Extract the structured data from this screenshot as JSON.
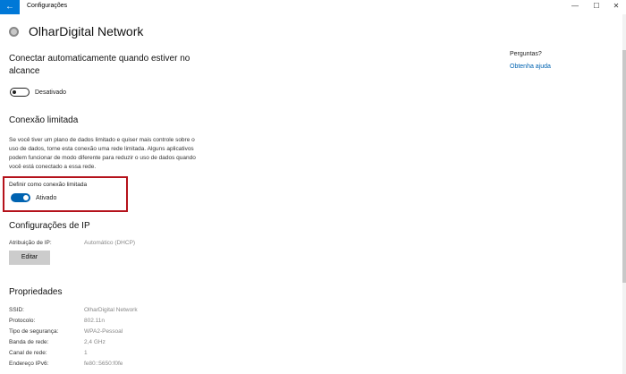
{
  "window": {
    "back_glyph": "←",
    "title": "Configurações",
    "minimize_glyph": "—",
    "maximize_glyph": "☐",
    "close_glyph": "✕"
  },
  "header": {
    "icon": "gear-icon",
    "title": "OlharDigital Network"
  },
  "autoconnect": {
    "title": "Conectar automaticamente quando estiver no alcance",
    "toggle_state": false,
    "toggle_label": "Desativado"
  },
  "metered": {
    "title": "Conexão limitada",
    "description": "Se você tiver um plano de dados limitado e quiser mais controle sobre o uso de dados, torne esta conexão uma rede limitada. Alguns aplicativos podem funcionar de modo diferente para reduzir o uso de dados quando você está conectado a essa rede.",
    "setting_label": "Definir como conexão limitada",
    "toggle_state": true,
    "toggle_label": "Ativado",
    "highlight_color": "#b5121b"
  },
  "ip": {
    "title": "Configurações de IP",
    "assignment_key": "Atribuição de IP:",
    "assignment_value": "Automático (DHCP)",
    "edit_label": "Editar"
  },
  "properties": {
    "title": "Propriedades",
    "rows": [
      {
        "key": "SSID:",
        "value": "OlharDigital Network"
      },
      {
        "key": "Protocolo:",
        "value": "802.11n"
      },
      {
        "key": "Tipo de segurança:",
        "value": "WPA2-Pessoal"
      },
      {
        "key": "Banda de rede:",
        "value": "2,4 GHz"
      },
      {
        "key": "Canal de rede:",
        "value": "1"
      },
      {
        "key": "Endereço IPv6:",
        "value": "fe80::5650:f0fe"
      }
    ]
  },
  "aside": {
    "title": "Perguntas?",
    "link": "Obtenha ajuda"
  },
  "colors": {
    "accent": "#0078d7",
    "toggle_on": "#0063b1",
    "link": "#0063b1"
  }
}
